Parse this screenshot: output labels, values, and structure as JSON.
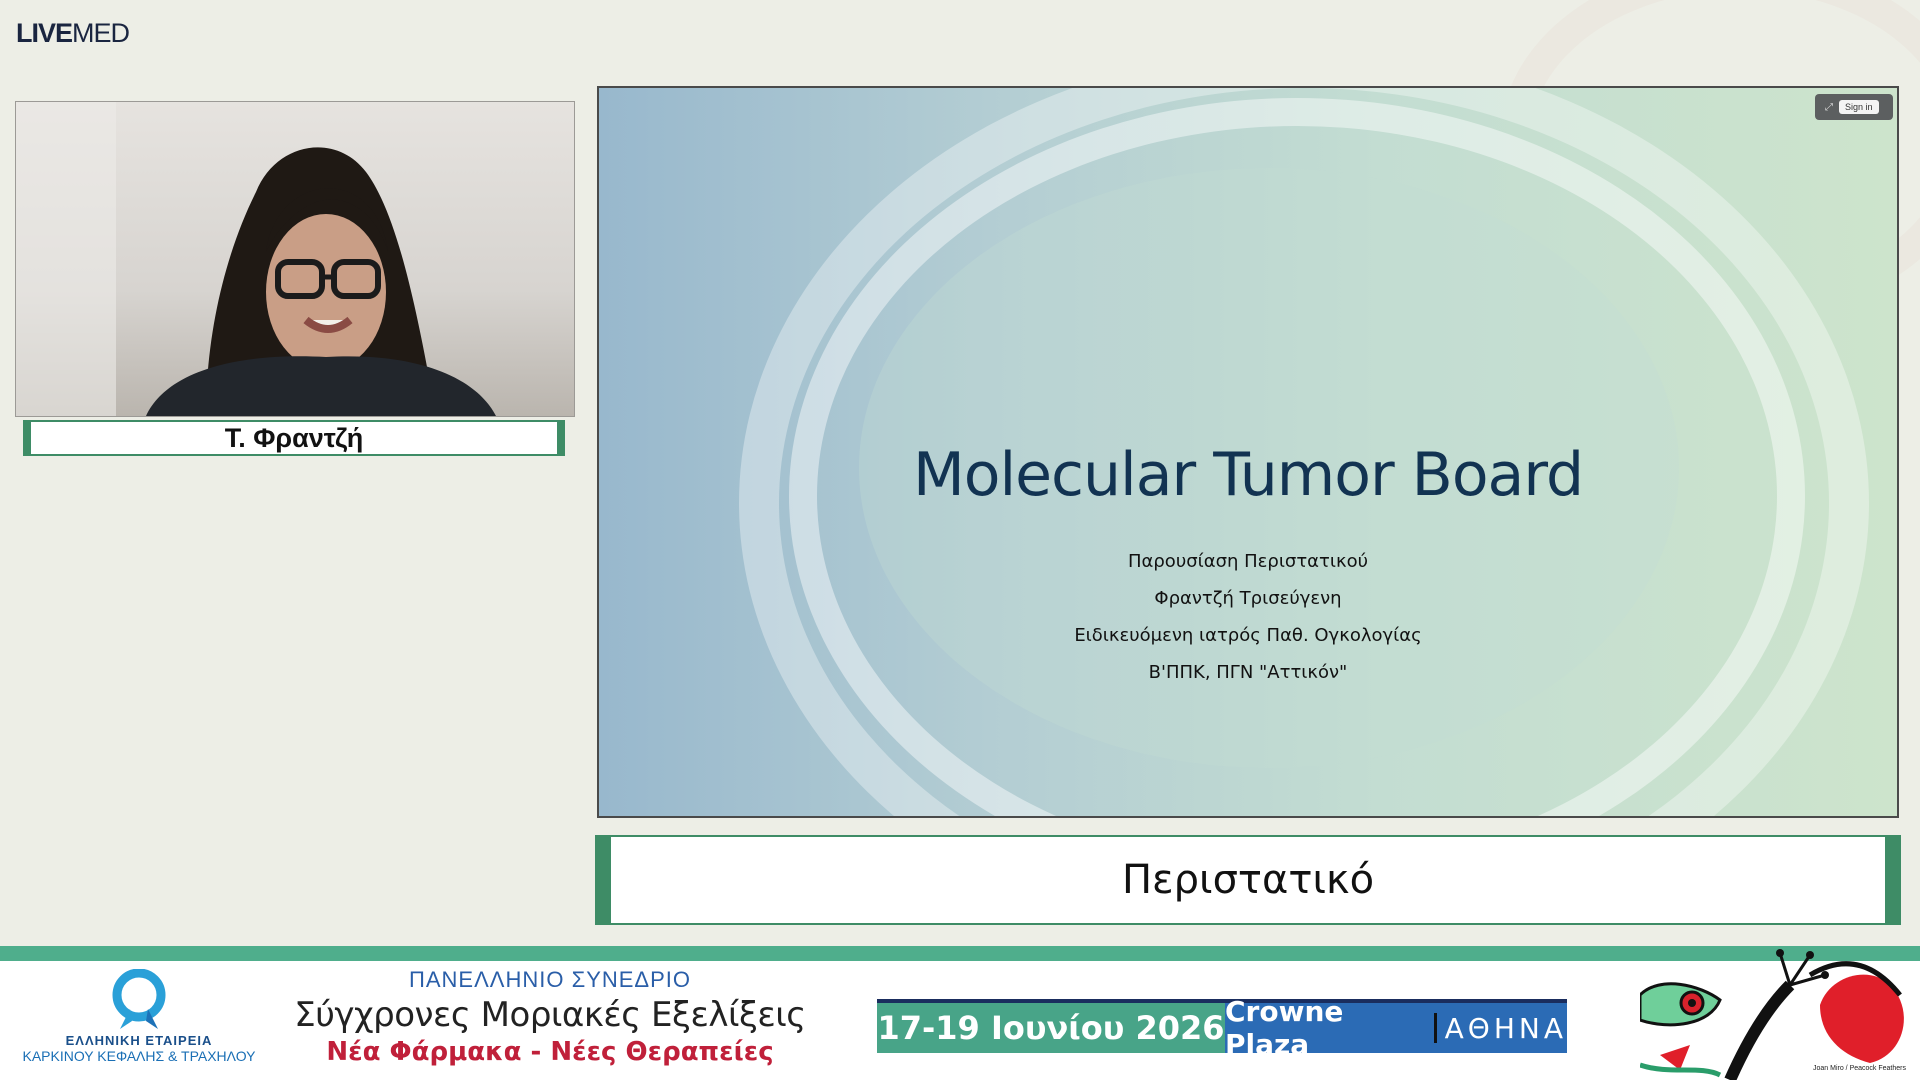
{
  "brand": {
    "live": "LIVE",
    "med": "MED"
  },
  "speaker": {
    "name": "Τ. Φραντζή"
  },
  "slide": {
    "title": "Molecular Tumor Board",
    "lines": [
      "Παρουσίαση Περιστατικού",
      "Φραντζή Τρισεύγενη",
      "Ειδικευόμενη ιατρός Παθ. Ογκολογίας",
      "Β'ΠΠΚ, ΠΓΝ \"Αττικόν\""
    ],
    "toolbar": {
      "expand_icon": "expand-icon",
      "sign_in": "Sign in"
    }
  },
  "caption": "Περιστατικό",
  "footer": {
    "org_line1": "ΕΛΛΗΝΙΚΗ ΕΤΑΙΡΕΙΑ",
    "org_line2": "ΚΑΡΚΙΝΟΥ ΚΕΦΑΛΗΣ & ΤΡΑΧΗΛΟΥ",
    "kicker": "ΠΑΝΕΛΛΗΝΙΟ ΣΥΝΕΔΡΙΟ",
    "conference": "Σύγχρονες Μοριακές Εξελίξεις",
    "subtitle": "Νέα Φάρμακα - Νέες Θεραπείες",
    "dates": "17-19 Ιουνίου 2026",
    "venue": "Crowne Plaza",
    "city": "ΑΘΗΝΑ",
    "art_caption": "Joan Miro / Peacock Feathers"
  },
  "colors": {
    "accent_green": "#3e8c66",
    "stripe_green": "#4fae8c",
    "slide_title": "#123352",
    "conference_red": "#c0203a",
    "venue_blue": "#2b6bb5"
  }
}
